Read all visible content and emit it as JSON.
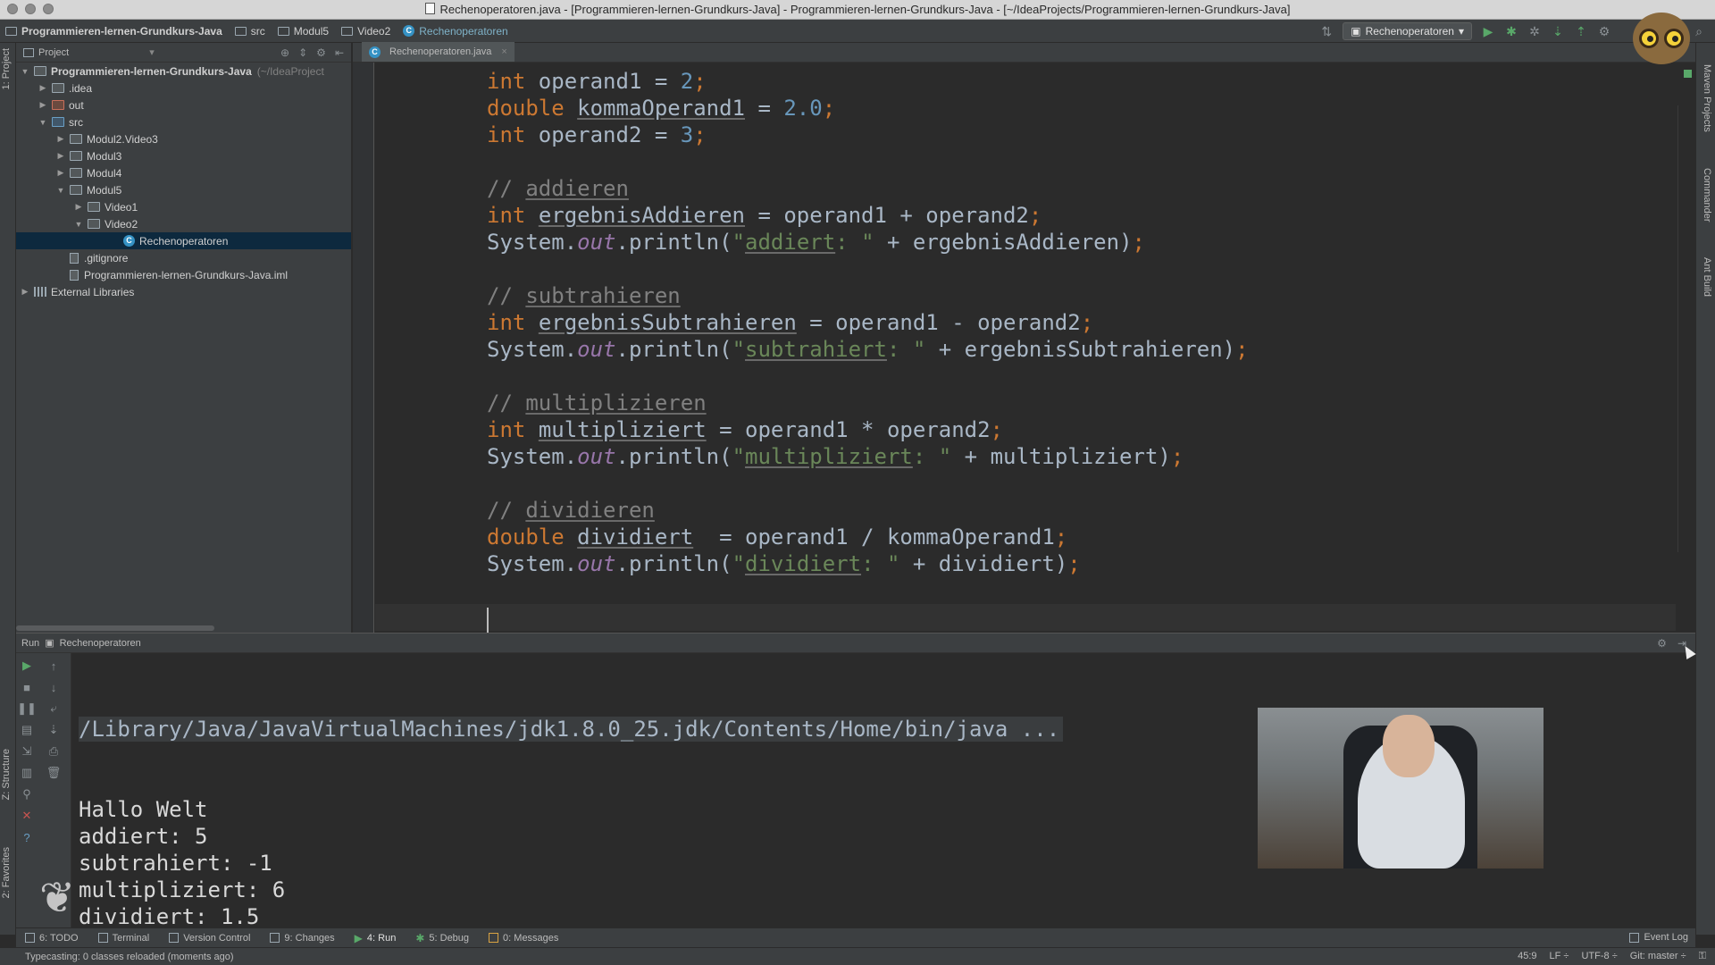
{
  "window": {
    "title": "Rechenoperatoren.java - [Programmieren-lernen-Grundkurs-Java] - Programmieren-lernen-Grundkurs-Java - [~/IdeaProjects/Programmieren-lernen-Grundkurs-Java]"
  },
  "breadcrumbs": [
    "Programmieren-lernen-Grundkurs-Java",
    "src",
    "Modul5",
    "Video2",
    "Rechenoperatoren"
  ],
  "toolbar": {
    "run_config": "Rechenoperatoren"
  },
  "side_tabs": {
    "left_top": "1: Project",
    "left_bottom_structure": "Z: Structure",
    "left_bottom_favorites": "2: Favorites",
    "right_maven": "Maven Projects",
    "right_commander": "Commander",
    "right_ant": "Ant Build"
  },
  "project_panel": {
    "header": "Project",
    "tree": [
      {
        "label": "Programmieren-lernen-Grundkurs-Java",
        "hint": "(~/IdeaProject",
        "indent": 0,
        "arrow": "▼",
        "icon": "folder",
        "bold": true
      },
      {
        "label": ".idea",
        "indent": 1,
        "arrow": "▶",
        "icon": "folder"
      },
      {
        "label": "out",
        "indent": 1,
        "arrow": "▶",
        "icon": "folder-red"
      },
      {
        "label": "src",
        "indent": 1,
        "arrow": "▼",
        "icon": "folder-blue"
      },
      {
        "label": "Modul2.Video3",
        "indent": 2,
        "arrow": "▶",
        "icon": "folder"
      },
      {
        "label": "Modul3",
        "indent": 2,
        "arrow": "▶",
        "icon": "folder"
      },
      {
        "label": "Modul4",
        "indent": 2,
        "arrow": "▶",
        "icon": "folder"
      },
      {
        "label": "Modul5",
        "indent": 2,
        "arrow": "▼",
        "icon": "folder"
      },
      {
        "label": "Video1",
        "indent": 3,
        "arrow": "▶",
        "icon": "folder"
      },
      {
        "label": "Video2",
        "indent": 3,
        "arrow": "▼",
        "icon": "folder"
      },
      {
        "label": "Rechenoperatoren",
        "indent": 5,
        "arrow": "",
        "icon": "class",
        "selected": true
      },
      {
        "label": ".gitignore",
        "indent": 2,
        "arrow": "",
        "icon": "file"
      },
      {
        "label": "Programmieren-lernen-Grundkurs-Java.iml",
        "indent": 2,
        "arrow": "",
        "icon": "file"
      },
      {
        "label": "External Libraries",
        "indent": 0,
        "arrow": "▶",
        "icon": "library"
      }
    ]
  },
  "editor": {
    "tab_label": "Rechenoperatoren.java",
    "code": [
      [
        [
          "kw",
          "int"
        ],
        [
          "p",
          " operand1 = "
        ],
        [
          "num",
          "2"
        ],
        [
          "kw",
          ";"
        ]
      ],
      [
        [
          "kw",
          "double"
        ],
        [
          "p",
          " "
        ],
        [
          "ul",
          "kommaOperand1"
        ],
        [
          "p",
          " = "
        ],
        [
          "num",
          "2.0"
        ],
        [
          "kw",
          ";"
        ]
      ],
      [
        [
          "kw",
          "int"
        ],
        [
          "p",
          " operand2 = "
        ],
        [
          "num",
          "3"
        ],
        [
          "kw",
          ";"
        ]
      ],
      [],
      [
        [
          "cmt",
          "// "
        ],
        [
          "cmtul",
          "addieren"
        ]
      ],
      [
        [
          "kw",
          "int"
        ],
        [
          "p",
          " "
        ],
        [
          "ul",
          "ergebnisAddieren"
        ],
        [
          "p",
          " = operand1 + operand2"
        ],
        [
          "kw",
          ";"
        ]
      ],
      [
        [
          "p",
          "System."
        ],
        [
          "fld",
          "out"
        ],
        [
          "p",
          ".println("
        ],
        [
          "str",
          "\""
        ],
        [
          "strul",
          "addiert"
        ],
        [
          "str",
          ": \""
        ],
        [
          "p",
          " + ergebnisAddieren)"
        ],
        [
          "kw",
          ";"
        ]
      ],
      [],
      [
        [
          "cmt",
          "// "
        ],
        [
          "cmtul",
          "subtrahieren"
        ]
      ],
      [
        [
          "kw",
          "int"
        ],
        [
          "p",
          " "
        ],
        [
          "ul",
          "ergebnisSubtrahieren"
        ],
        [
          "p",
          " = operand1 - operand2"
        ],
        [
          "kw",
          ";"
        ]
      ],
      [
        [
          "p",
          "System."
        ],
        [
          "fld",
          "out"
        ],
        [
          "p",
          ".println("
        ],
        [
          "str",
          "\""
        ],
        [
          "strul",
          "subtrahiert"
        ],
        [
          "str",
          ": \""
        ],
        [
          "p",
          " + ergebnisSubtrahieren)"
        ],
        [
          "kw",
          ";"
        ]
      ],
      [],
      [
        [
          "cmt",
          "// "
        ],
        [
          "cmtul",
          "multiplizieren"
        ]
      ],
      [
        [
          "kw",
          "int"
        ],
        [
          "p",
          " "
        ],
        [
          "ul",
          "multipliziert"
        ],
        [
          "p",
          " = operand1 * operand2"
        ],
        [
          "kw",
          ";"
        ]
      ],
      [
        [
          "p",
          "System."
        ],
        [
          "fld",
          "out"
        ],
        [
          "p",
          ".println("
        ],
        [
          "str",
          "\""
        ],
        [
          "strul",
          "multipliziert"
        ],
        [
          "str",
          ": \""
        ],
        [
          "p",
          " + multipliziert)"
        ],
        [
          "kw",
          ";"
        ]
      ],
      [],
      [
        [
          "cmt",
          "// "
        ],
        [
          "cmtul",
          "dividieren"
        ]
      ],
      [
        [
          "kw",
          "double"
        ],
        [
          "p",
          " "
        ],
        [
          "ul",
          "dividiert"
        ],
        [
          "p",
          "  = operand1 / kommaOperand1"
        ],
        [
          "kw",
          ";"
        ]
      ],
      [
        [
          "p",
          "System."
        ],
        [
          "fld",
          "out"
        ],
        [
          "p",
          ".println("
        ],
        [
          "str",
          "\""
        ],
        [
          "strul",
          "dividiert"
        ],
        [
          "str",
          ": \""
        ],
        [
          "p",
          " + dividiert)"
        ],
        [
          "kw",
          ";"
        ]
      ]
    ]
  },
  "run_panel": {
    "title_prefix": "Run",
    "title": "Rechenoperatoren",
    "command": "/Library/Java/JavaVirtualMachines/jdk1.8.0_25.jdk/Contents/Home/bin/java ...",
    "output": [
      "Hallo Welt",
      "addiert: 5",
      "subtrahiert: -1",
      "multipliziert: 6",
      "dividiert: 1.5"
    ]
  },
  "tool_windows": {
    "todo": "6: TODO",
    "terminal": "Terminal",
    "version_control": "Version Control",
    "changes": "9: Changes",
    "run": "4: Run",
    "debug": "5: Debug",
    "messages": "0: Messages",
    "event_log": "Event Log"
  },
  "status": {
    "message": "Typecasting: 0 classes reloaded (moments ago)",
    "position": "45:9",
    "line_sep": "LF ÷",
    "encoding": "UTF-8 ÷",
    "git": "Git: master ÷"
  }
}
